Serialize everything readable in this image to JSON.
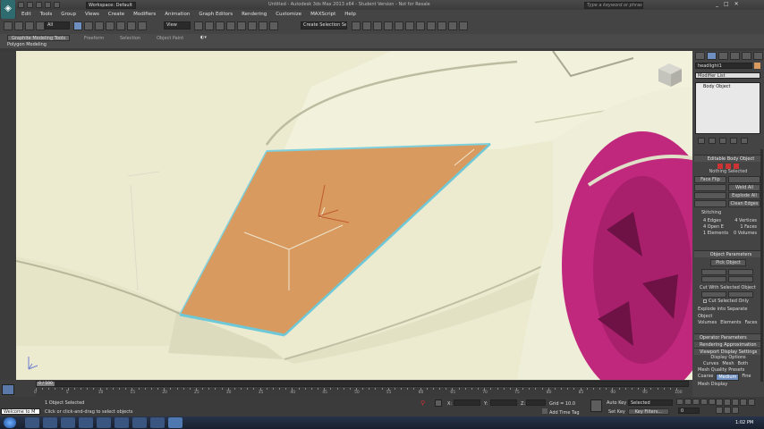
{
  "titlebar": {
    "workspace": "Workspace: Default",
    "window_title": "Untitled - Autodesk 3ds Max 2013 x64 - Student Version - Not for Resale",
    "search_placeholder": "Type a keyword or phrase"
  },
  "menu": [
    "Edit",
    "Tools",
    "Group",
    "Views",
    "Create",
    "Modifiers",
    "Animation",
    "Graph Editors",
    "Rendering",
    "Customize",
    "MAXScript",
    "Help"
  ],
  "toolbar": {
    "selection_filter": "All",
    "ref_coord": "View",
    "named_selection": "Create Selection Se"
  },
  "ribbon": {
    "tabs": [
      "Graphite Modeling Tools",
      "Freeform",
      "Selection",
      "Object Paint"
    ],
    "sub_label": "Polygon Modeling"
  },
  "cmdpanel": {
    "object_name": "headlight1",
    "modifier_list": "Modifier List",
    "stack_item": "Body Object",
    "rollout_editable": "Editable Body Object",
    "nothing_selected": "Nothing Selected",
    "face_flip": "Face Flip",
    "weld_all": "Weld All",
    "explode_all": "Explode All",
    "clean_edges": "Clean Edges",
    "stitching": "Stitching",
    "stats": [
      [
        "4 Edges",
        "4 Vertices"
      ],
      [
        "4 Open E",
        "1 Faces"
      ],
      [
        "1 Elements",
        "0 Volumes"
      ]
    ],
    "rollout_params": "Object Parameters",
    "pick_object": "Pick Object",
    "cut_with": "Cut With Selected Object",
    "cut_selected_only": "Cut Selected Only",
    "explode_into": "Explode into Separate Object",
    "explode_tabs": [
      "Volumes",
      "Elements",
      "Faces"
    ],
    "operator_params": "Operator Parameters",
    "rendering_approx": "Rendering Approximation",
    "viewport_display": "Viewport Display Settings",
    "display_options": "Display Options",
    "display_radios": [
      "Curves",
      "Mesh",
      "Both"
    ],
    "mesh_quality": "Mesh Quality Presets",
    "quality_opts": [
      "Coarse",
      "Medium",
      "Fine"
    ],
    "mesh_display": "Mesh Display"
  },
  "timeline": {
    "frame": "0 / 100",
    "ticks": [
      "0",
      "5",
      "10",
      "15",
      "20",
      "25",
      "30",
      "35",
      "40",
      "45",
      "50",
      "55",
      "60",
      "65",
      "70",
      "75",
      "80",
      "85",
      "90",
      "95",
      "100"
    ]
  },
  "status": {
    "maxscript": "Welcome to M",
    "line1": "1 Object Selected",
    "line2": "Click or click-and-drag to select objects",
    "x_label": "X:",
    "y_label": "Y:",
    "z_label": "Z:",
    "grid": "Grid = 10.0",
    "add_time_tag": "Add Time Tag",
    "auto_key": "Auto Key",
    "set_key": "Set Key",
    "selected": "Selected",
    "key_filters": "Key Filters...",
    "frame_field": "0"
  },
  "taskbar": {
    "time": "1:02 PM"
  },
  "colors": {
    "car_body": "#ecebd0",
    "headlight": "#d89a5f",
    "selection_edge": "#6ec8d8",
    "wheel": "#c0287e"
  }
}
